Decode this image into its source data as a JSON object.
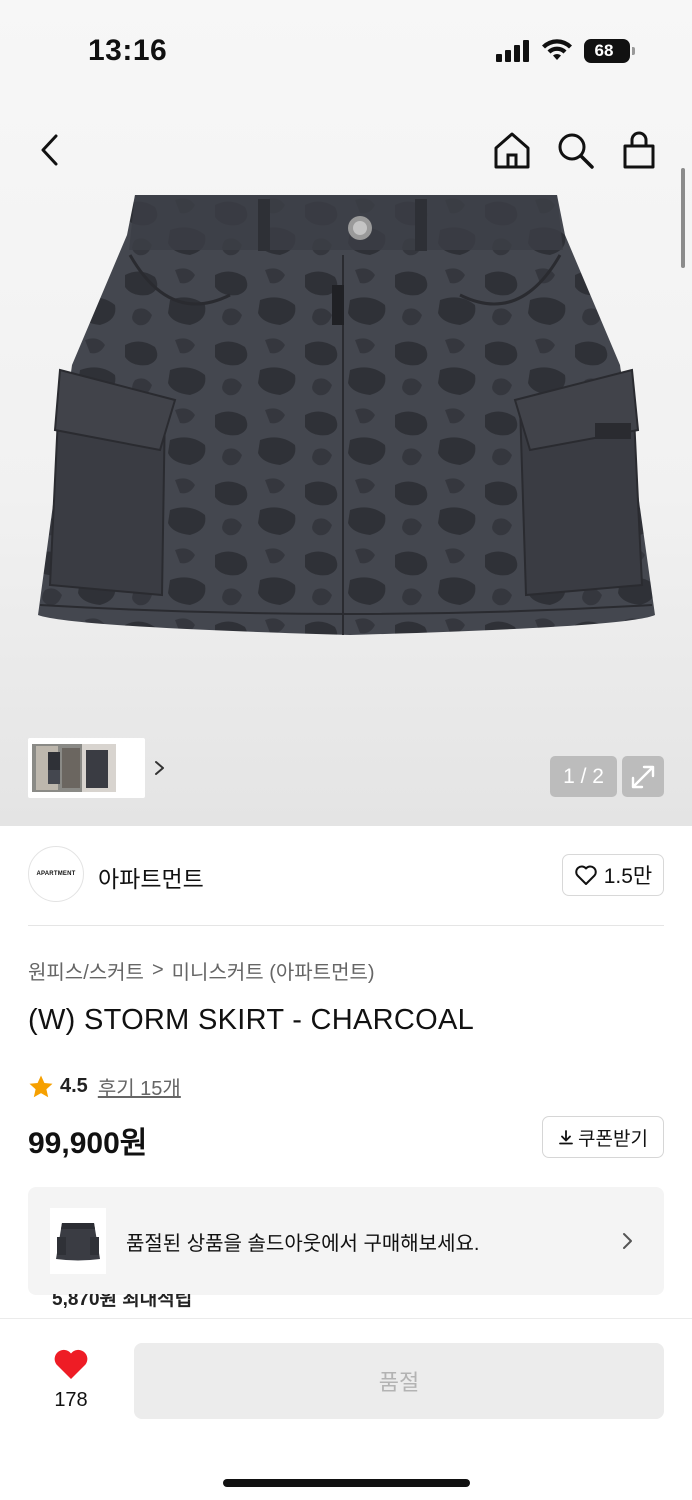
{
  "status_bar": {
    "time": "13:16",
    "battery": "68"
  },
  "gallery": {
    "counter": "1 / 2"
  },
  "brand": {
    "logo_text": "APARTMENT",
    "name": "아파트먼트",
    "likes": "1.5만"
  },
  "breadcrumb": {
    "category": "원피스/스커트",
    "separator": ">",
    "subcategory": "미니스커트 (아파트먼트)"
  },
  "product": {
    "title": "(W) STORM SKIRT - CHARCOAL",
    "rating": "4.5",
    "reviews": "후기 15개",
    "price": "99,900원"
  },
  "coupon": {
    "label": "쿠폰받기"
  },
  "soldout_banner": {
    "text": "품절된 상품을 솔드아웃에서 구매해보세요."
  },
  "peek": {
    "text": "5,870원 최대적립"
  },
  "bottom_bar": {
    "wish_count": "178",
    "buy_label": "품절"
  },
  "colors": {
    "heart": "#ee1c25",
    "star": "#f6a000",
    "skirt": "#3a3d44"
  },
  "icons": [
    "back-icon",
    "home-icon",
    "search-icon",
    "bag-icon",
    "expand-icon",
    "chevron-right-icon",
    "heart-outline-icon",
    "star-icon",
    "download-icon",
    "heart-filled-icon"
  ]
}
